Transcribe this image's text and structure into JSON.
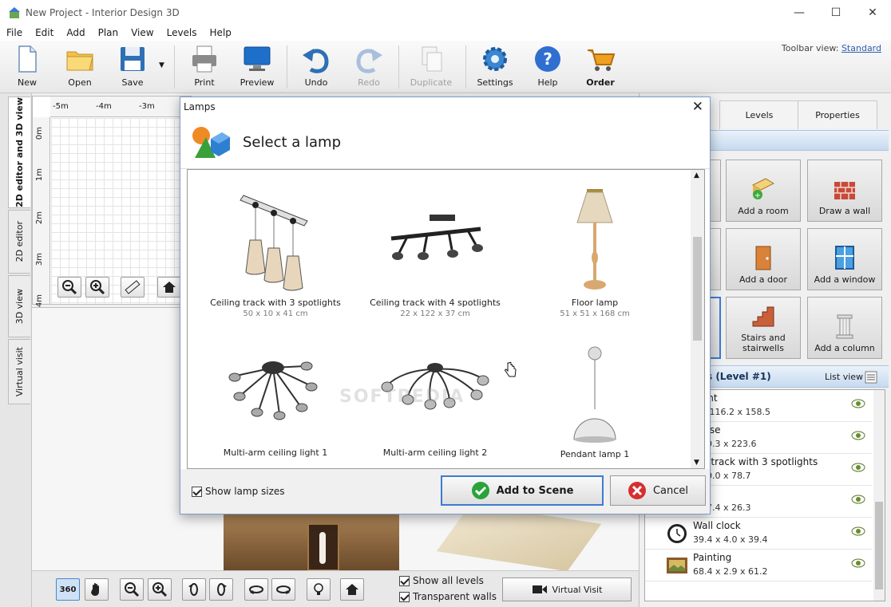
{
  "window": {
    "title": "New Project - Interior Design 3D",
    "minimize": "—",
    "maximize": "☐",
    "close": "✕"
  },
  "menu": [
    "File",
    "Edit",
    "Add",
    "Plan",
    "View",
    "Levels",
    "Help"
  ],
  "toolbar": {
    "new": "New",
    "open": "Open",
    "save": "Save",
    "print": "Print",
    "preview": "Preview",
    "undo": "Undo",
    "redo": "Redo",
    "duplicate": "Duplicate",
    "settings": "Settings",
    "help": "Help",
    "order": "Order",
    "view_label": "Toolbar view:",
    "view_value": "Standard"
  },
  "left_tabs": [
    "2D editor and 3D view",
    "2D editor",
    "3D view",
    "Virtual visit"
  ],
  "editor2d": {
    "ruler_x": [
      "-5m",
      "-4m",
      "-3m"
    ],
    "ruler_y": [
      "0m",
      "1m",
      "2m",
      "3m",
      "4m"
    ]
  },
  "bottom": {
    "show_all_levels": "Show all levels",
    "transparent_walls": "Transparent walls",
    "virtual_visit": "Virtual Visit",
    "btn_360": "360"
  },
  "right_panel": {
    "tabs": [
      "Levels",
      "Properties"
    ],
    "tiles": [
      {
        "label": "Add a room",
        "icon": "add-room-icon"
      },
      {
        "label": "Draw a wall",
        "icon": "wall-icon"
      },
      {
        "label": "Add a door",
        "icon": "door-icon"
      },
      {
        "label": "Add a window",
        "icon": "window-icon"
      },
      {
        "label": "Stairs and stairwells",
        "icon": "stairs-icon"
      },
      {
        "label": "Add a column",
        "icon": "column-icon"
      }
    ],
    "objects_header": "s (Level #1)",
    "list_view": "List view",
    "objects": [
      {
        "name": "plant",
        "dims": "4 x 116.2 x 158.5"
      },
      {
        "name": "kcase",
        "dims": "x 40.3 x 223.6"
      },
      {
        "name": "ing track with 3 spotlights",
        "dims": "x 10.0 x 78.7"
      },
      {
        "name": "op",
        "dims": "x 27.4 x 26.3"
      },
      {
        "name": "Wall clock",
        "dims": "39.4 x 4.0 x 39.4"
      },
      {
        "name": "Painting",
        "dims": "68.4 x 2.9 x 61.2"
      }
    ]
  },
  "dialog": {
    "title": "Lamps",
    "heading": "Select a lamp",
    "show_sizes": "Show lamp sizes",
    "add_btn": "Add to Scene",
    "cancel_btn": "Cancel",
    "watermark": "SOFTPEDIA",
    "lamps": [
      {
        "name": "Ceiling track with 3 spotlights",
        "size": "50 x 10 x 41 cm"
      },
      {
        "name": "Ceiling track with 4 spotlights",
        "size": "22 x 122 x 37 cm"
      },
      {
        "name": "Floor lamp",
        "size": "51 x 51 x 168 cm"
      },
      {
        "name": "Multi-arm ceiling light 1",
        "size": ""
      },
      {
        "name": "Multi-arm ceiling light 2",
        "size": ""
      },
      {
        "name": "Pendant lamp 1",
        "size": ""
      }
    ]
  },
  "colors": {
    "accent": "#3d7bd0",
    "panel_band": "#c7daf0",
    "ok_green": "#2aa33a",
    "cancel_red": "#d62f2f"
  }
}
